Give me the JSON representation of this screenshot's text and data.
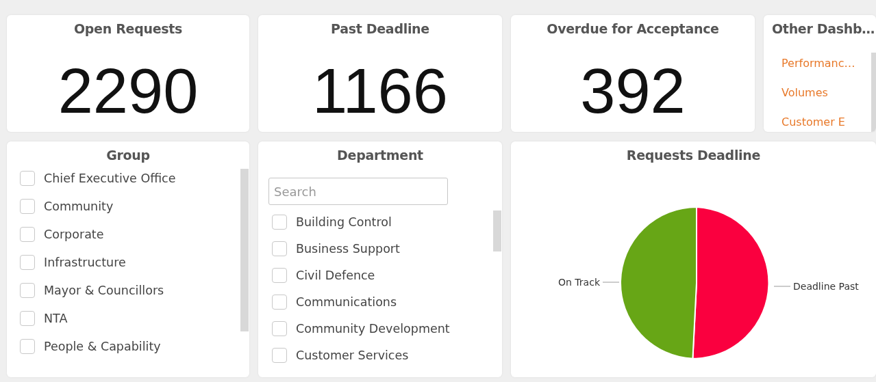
{
  "kpis": [
    {
      "title": "Open Requests",
      "value": "2290"
    },
    {
      "title": "Past Deadline",
      "value": "1166"
    },
    {
      "title": "Overdue for Acceptance",
      "value": "392"
    }
  ],
  "other_dashboards": {
    "title": "Other Dashb…",
    "links": [
      "Performanc…",
      "Volumes",
      "Customer E"
    ]
  },
  "group_filter": {
    "title": "Group",
    "items": [
      {
        "label": "Chief Executive Office",
        "checked": false
      },
      {
        "label": "Community",
        "checked": false
      },
      {
        "label": "Corporate",
        "checked": false
      },
      {
        "label": "Infrastructure",
        "checked": false
      },
      {
        "label": "Mayor & Councillors",
        "checked": false
      },
      {
        "label": "NTA",
        "checked": false
      },
      {
        "label": "People & Capability",
        "checked": false
      }
    ]
  },
  "department_filter": {
    "title": "Department",
    "search": {
      "placeholder": "Search"
    },
    "items": [
      {
        "label": "Building Control",
        "checked": false
      },
      {
        "label": "Business Support",
        "checked": false
      },
      {
        "label": "Civil Defence",
        "checked": false
      },
      {
        "label": "Communications",
        "checked": false
      },
      {
        "label": "Community Development",
        "checked": false
      },
      {
        "label": "Customer Services",
        "checked": false
      }
    ]
  },
  "requests_deadline": {
    "title": "Requests Deadline",
    "slices": [
      {
        "label": "Deadline Past",
        "color": "#fa003f"
      },
      {
        "label": "On Track",
        "color": "#67a616"
      }
    ]
  }
}
